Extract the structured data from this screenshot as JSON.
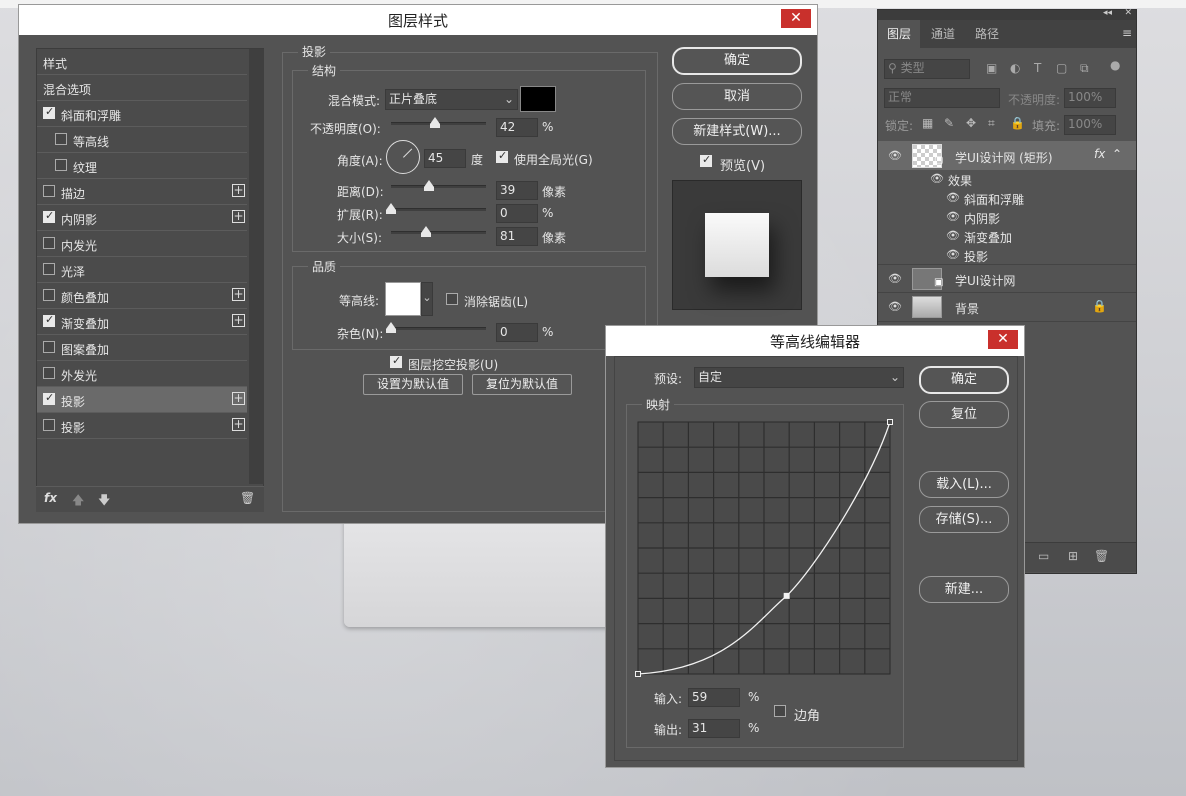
{
  "layer_style": {
    "title": "图层样式",
    "close": "✕",
    "style_items": [
      {
        "label": "样式",
        "check": null,
        "plus": false,
        "indent": 0
      },
      {
        "label": "混合选项",
        "check": null,
        "plus": false,
        "indent": 0
      },
      {
        "label": "斜面和浮雕",
        "check": true,
        "plus": false,
        "indent": 0
      },
      {
        "label": "等高线",
        "check": false,
        "plus": false,
        "indent": 1
      },
      {
        "label": "纹理",
        "check": false,
        "plus": false,
        "indent": 1
      },
      {
        "label": "描边",
        "check": false,
        "plus": true,
        "indent": 0
      },
      {
        "label": "内阴影",
        "check": true,
        "plus": true,
        "indent": 0
      },
      {
        "label": "内发光",
        "check": false,
        "plus": false,
        "indent": 0
      },
      {
        "label": "光泽",
        "check": false,
        "plus": false,
        "indent": 0
      },
      {
        "label": "颜色叠加",
        "check": false,
        "plus": true,
        "indent": 0
      },
      {
        "label": "渐变叠加",
        "check": true,
        "plus": true,
        "indent": 0
      },
      {
        "label": "图案叠加",
        "check": false,
        "plus": false,
        "indent": 0
      },
      {
        "label": "外发光",
        "check": false,
        "plus": false,
        "indent": 0
      },
      {
        "label": "投影",
        "check": true,
        "plus": true,
        "indent": 0,
        "selected": true
      },
      {
        "label": "投影",
        "check": false,
        "plus": true,
        "indent": 0
      }
    ],
    "fx": "fx",
    "section_title": "投影",
    "structure_title": "结构",
    "blend_mode_label": "混合模式:",
    "blend_mode_value": "正片叠底",
    "opacity_label": "不透明度(O):",
    "opacity_value": "42",
    "opacity_pct": 42,
    "angle_label": "角度(A):",
    "angle_value": "45",
    "angle_unit": "度",
    "global_light_label": "使用全局光(G)",
    "distance_label": "距离(D):",
    "distance_value": "39",
    "distance_unit": "像素",
    "spread_label": "扩展(R):",
    "spread_value": "0",
    "size_label": "大小(S):",
    "size_value": "81",
    "size_unit": "像素",
    "percent": "%",
    "quality_title": "品质",
    "contour_label": "等高线:",
    "antialias_label": "消除锯齿(L)",
    "noise_label": "杂色(N):",
    "noise_value": "0",
    "knockout_label": "图层挖空投影(U)",
    "set_default": "设置为默认值",
    "reset_default": "复位为默认值",
    "ok": "确定",
    "cancel": "取消",
    "new_style": "新建样式(W)...",
    "preview_label": "预览(V)"
  },
  "layers_panel": {
    "tabs": [
      "图层",
      "通道",
      "路径"
    ],
    "kind_placeholder": "类型",
    "blend": "正常",
    "opacity_label": "不透明度:",
    "opacity_value": "100%",
    "lock_label": "锁定:",
    "fill_label": "填充:",
    "fill_value": "100%",
    "layer1": "学UI设计网 (矩形)",
    "effects_label": "效果",
    "effects": [
      "斜面和浮雕",
      "内阴影",
      "渐变叠加",
      "投影"
    ],
    "layer2": "学UI设计网",
    "background": "背景"
  },
  "contour_editor": {
    "title": "等高线编辑器",
    "close": "✕",
    "preset_label": "预设:",
    "preset_value": "自定",
    "mapping_title": "映射",
    "input_label": "输入:",
    "input_value": "59",
    "output_label": "输出:",
    "output_value": "31",
    "percent": "%",
    "corner_label": "边角",
    "ok": "确定",
    "reset": "复位",
    "load": "载入(L)...",
    "save": "存储(S)...",
    "new": "新建...",
    "curve_points": [
      [
        0,
        0
      ],
      [
        59,
        31
      ],
      [
        100,
        100
      ]
    ]
  }
}
